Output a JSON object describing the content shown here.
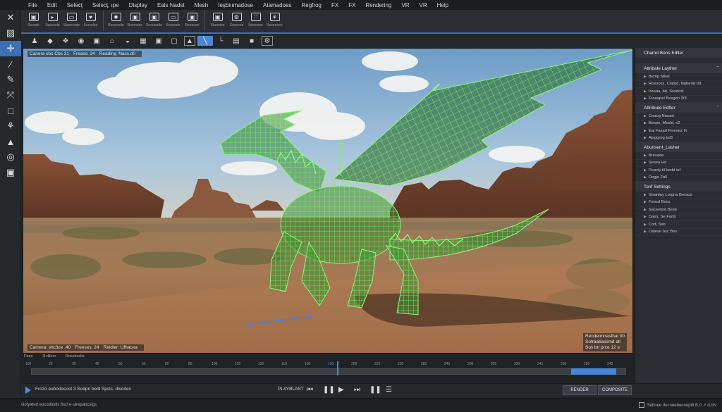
{
  "menu": [
    "File",
    "Edit",
    "Selecţ",
    "Selecţ, ıрe",
    "Display",
    "Eals Nadst",
    "Mesh",
    "İeşbiıımadose",
    "Atamadoes",
    "Regfrog",
    "FX",
    "FX",
    "Rendering",
    "VR",
    "VR",
    "Help"
  ],
  "shelf": {
    "buttons": [
      {
        "icon": "cube-icon",
        "glyph": "▣",
        "label": "Sxocde"
      },
      {
        "icon": "cursor-icon",
        "glyph": "▸",
        "label": "Swecode"
      },
      {
        "icon": "monitor-icon",
        "glyph": "▭",
        "label": "Swoecode"
      },
      {
        "icon": "shield-icon",
        "glyph": "♥",
        "label": "Secodue"
      },
      {
        "icon": "brush-icon",
        "glyph": "✹",
        "label": "Bnuecode"
      },
      {
        "icon": "monitor-icon",
        "glyph": "▣",
        "label": "Boomooe"
      },
      {
        "icon": "box-icon",
        "glyph": "▣",
        "label": "Snoooade"
      },
      {
        "icon": "monitor-icon",
        "glyph": "▭",
        "label": "Snooade"
      },
      {
        "icon": "render-icon",
        "glyph": "▣",
        "label": "Reoaoee"
      },
      {
        "icon": "camera-icon",
        "glyph": "▣",
        "label": "Sboodee"
      },
      {
        "icon": "gear-icon",
        "glyph": "⚙",
        "label": "Seosooe"
      },
      {
        "icon": "grid-icon",
        "glyph": "∷",
        "label": "Swoooee"
      },
      {
        "icon": "wheel-icon",
        "glyph": "⚘",
        "label": "Sesenoee"
      }
    ]
  },
  "toolbox": [
    "close-icon",
    "select-icon",
    "move-icon",
    "brush-icon",
    "pen-icon",
    "scale-icon",
    "crop-icon",
    "sculpt-icon",
    "paint-icon",
    "connect-icon",
    "snap-icon"
  ],
  "toolbar2": [
    "♟",
    "◆",
    "❖",
    "◉",
    "▣",
    "⌂",
    "◒",
    "▦",
    "▣",
    "▢",
    "▲",
    "╲",
    "└",
    "▤",
    "■",
    "⚙"
  ],
  "viewport": {
    "hud_top": [
      "Canera sbo Cbs 31",
      "Freass: 24",
      "Reading ‘Nass.d0"
    ],
    "hud_bottom": [
      "Camera: shc3ce .40",
      "Freeses: 24",
      "Reidier: Ufhacea"
    ],
    "hud_bottom_right": [
      "Rendeimnasthal 00",
      "Sotraatiassmd alt",
      "Sos bn prce 12 ≤"
    ]
  },
  "rpanel": {
    "sections": [
      {
        "title": "Chamd Bons Edlter",
        "rows": []
      },
      {
        "title": "Attribale Layther",
        "rows": [
          "Bemp Nikal",
          "Rosoces, Ciamd, Naberat tld",
          "Irooaa, bb, Sssdosl",
          "Froaapel Besgon 2t3"
        ]
      },
      {
        "title": "Attriibute Edfter",
        "rows": [
          "Coaog Nuuad",
          "Bespe, Mosld, x2",
          "Eai Fasad Finnsez th",
          "Ajsggrog bd3"
        ]
      },
      {
        "title": "Abunsent_Lasher",
        "rows": [
          "Bresade",
          "Sesea Hd",
          "Peacty.til bedd tsf",
          "Degjo 2a5"
        ]
      },
      {
        "title": "Tonf Settings",
        "rows": [
          "Sisanlay Lorgna Beraus",
          "Fobsd Bocs",
          "Saceefasl Bese",
          "Daso, Se Fonb",
          "Cod, Ssb",
          "Ostese bsc Bss"
        ]
      }
    ]
  },
  "timeline": {
    "head": [
      "Foao",
      "2l dliore",
      "Rosokcelle"
    ],
    "ticks": [
      "100",
      "20",
      "30",
      "40",
      "50",
      "60",
      "80",
      "80",
      "100",
      "120",
      "130",
      "110",
      "100",
      "100",
      "200",
      "220",
      "230",
      "280",
      "240",
      "200",
      "220",
      "230",
      "241",
      "230",
      "260",
      "240"
    ]
  },
  "transport": {
    "text": "Frozo aubodasost 3 Sodpn bedl Spsls. dlsodes",
    "label": "PLAYBLAST",
    "render": "RENDER",
    "composite": "COMPOSITE"
  },
  "status": {
    "left": "viotyated epcodostls fiscl e-ulrepabcsigs",
    "right": "Sebnee decneebeonepdl B,0 ↗ d.oN"
  }
}
